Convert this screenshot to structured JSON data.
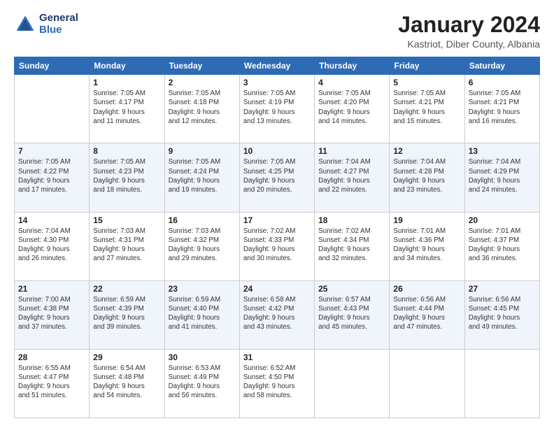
{
  "header": {
    "logo_line1": "General",
    "logo_line2": "Blue",
    "title": "January 2024",
    "subtitle": "Kastriot, Diber County, Albania"
  },
  "weekdays": [
    "Sunday",
    "Monday",
    "Tuesday",
    "Wednesday",
    "Thursday",
    "Friday",
    "Saturday"
  ],
  "weeks": [
    [
      {
        "day": "",
        "detail": ""
      },
      {
        "day": "1",
        "detail": "Sunrise: 7:05 AM\nSunset: 4:17 PM\nDaylight: 9 hours\nand 11 minutes."
      },
      {
        "day": "2",
        "detail": "Sunrise: 7:05 AM\nSunset: 4:18 PM\nDaylight: 9 hours\nand 12 minutes."
      },
      {
        "day": "3",
        "detail": "Sunrise: 7:05 AM\nSunset: 4:19 PM\nDaylight: 9 hours\nand 13 minutes."
      },
      {
        "day": "4",
        "detail": "Sunrise: 7:05 AM\nSunset: 4:20 PM\nDaylight: 9 hours\nand 14 minutes."
      },
      {
        "day": "5",
        "detail": "Sunrise: 7:05 AM\nSunset: 4:21 PM\nDaylight: 9 hours\nand 15 minutes."
      },
      {
        "day": "6",
        "detail": "Sunrise: 7:05 AM\nSunset: 4:21 PM\nDaylight: 9 hours\nand 16 minutes."
      }
    ],
    [
      {
        "day": "7",
        "detail": "Sunrise: 7:05 AM\nSunset: 4:22 PM\nDaylight: 9 hours\nand 17 minutes."
      },
      {
        "day": "8",
        "detail": "Sunrise: 7:05 AM\nSunset: 4:23 PM\nDaylight: 9 hours\nand 18 minutes."
      },
      {
        "day": "9",
        "detail": "Sunrise: 7:05 AM\nSunset: 4:24 PM\nDaylight: 9 hours\nand 19 minutes."
      },
      {
        "day": "10",
        "detail": "Sunrise: 7:05 AM\nSunset: 4:25 PM\nDaylight: 9 hours\nand 20 minutes."
      },
      {
        "day": "11",
        "detail": "Sunrise: 7:04 AM\nSunset: 4:27 PM\nDaylight: 9 hours\nand 22 minutes."
      },
      {
        "day": "12",
        "detail": "Sunrise: 7:04 AM\nSunset: 4:28 PM\nDaylight: 9 hours\nand 23 minutes."
      },
      {
        "day": "13",
        "detail": "Sunrise: 7:04 AM\nSunset: 4:29 PM\nDaylight: 9 hours\nand 24 minutes."
      }
    ],
    [
      {
        "day": "14",
        "detail": "Sunrise: 7:04 AM\nSunset: 4:30 PM\nDaylight: 9 hours\nand 26 minutes."
      },
      {
        "day": "15",
        "detail": "Sunrise: 7:03 AM\nSunset: 4:31 PM\nDaylight: 9 hours\nand 27 minutes."
      },
      {
        "day": "16",
        "detail": "Sunrise: 7:03 AM\nSunset: 4:32 PM\nDaylight: 9 hours\nand 29 minutes."
      },
      {
        "day": "17",
        "detail": "Sunrise: 7:02 AM\nSunset: 4:33 PM\nDaylight: 9 hours\nand 30 minutes."
      },
      {
        "day": "18",
        "detail": "Sunrise: 7:02 AM\nSunset: 4:34 PM\nDaylight: 9 hours\nand 32 minutes."
      },
      {
        "day": "19",
        "detail": "Sunrise: 7:01 AM\nSunset: 4:36 PM\nDaylight: 9 hours\nand 34 minutes."
      },
      {
        "day": "20",
        "detail": "Sunrise: 7:01 AM\nSunset: 4:37 PM\nDaylight: 9 hours\nand 36 minutes."
      }
    ],
    [
      {
        "day": "21",
        "detail": "Sunrise: 7:00 AM\nSunset: 4:38 PM\nDaylight: 9 hours\nand 37 minutes."
      },
      {
        "day": "22",
        "detail": "Sunrise: 6:59 AM\nSunset: 4:39 PM\nDaylight: 9 hours\nand 39 minutes."
      },
      {
        "day": "23",
        "detail": "Sunrise: 6:59 AM\nSunset: 4:40 PM\nDaylight: 9 hours\nand 41 minutes."
      },
      {
        "day": "24",
        "detail": "Sunrise: 6:58 AM\nSunset: 4:42 PM\nDaylight: 9 hours\nand 43 minutes."
      },
      {
        "day": "25",
        "detail": "Sunrise: 6:57 AM\nSunset: 4:43 PM\nDaylight: 9 hours\nand 45 minutes."
      },
      {
        "day": "26",
        "detail": "Sunrise: 6:56 AM\nSunset: 4:44 PM\nDaylight: 9 hours\nand 47 minutes."
      },
      {
        "day": "27",
        "detail": "Sunrise: 6:56 AM\nSunset: 4:45 PM\nDaylight: 9 hours\nand 49 minutes."
      }
    ],
    [
      {
        "day": "28",
        "detail": "Sunrise: 6:55 AM\nSunset: 4:47 PM\nDaylight: 9 hours\nand 51 minutes."
      },
      {
        "day": "29",
        "detail": "Sunrise: 6:54 AM\nSunset: 4:48 PM\nDaylight: 9 hours\nand 54 minutes."
      },
      {
        "day": "30",
        "detail": "Sunrise: 6:53 AM\nSunset: 4:49 PM\nDaylight: 9 hours\nand 56 minutes."
      },
      {
        "day": "31",
        "detail": "Sunrise: 6:52 AM\nSunset: 4:50 PM\nDaylight: 9 hours\nand 58 minutes."
      },
      {
        "day": "",
        "detail": ""
      },
      {
        "day": "",
        "detail": ""
      },
      {
        "day": "",
        "detail": ""
      }
    ]
  ]
}
